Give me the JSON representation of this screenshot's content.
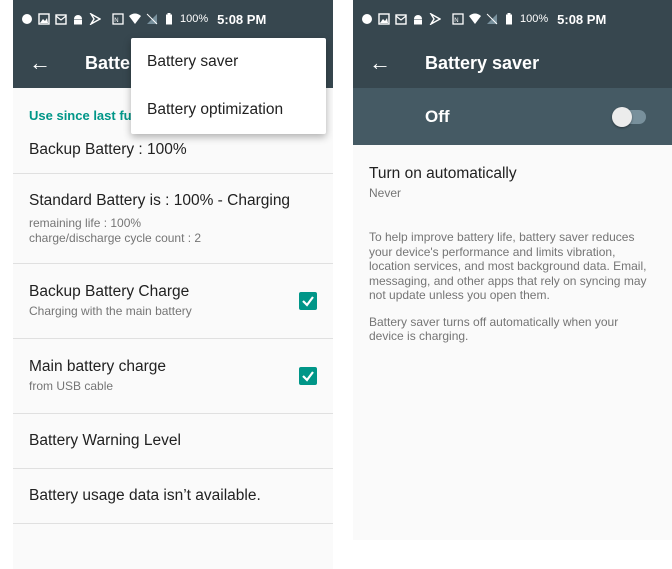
{
  "status_bar": {
    "battery_percent": "100%",
    "time": "5:08 PM",
    "icons": [
      "notification-dot-icon",
      "image-icon",
      "mail-icon",
      "android-icon",
      "flag-icon",
      "nfc-icon",
      "wifi-icon",
      "no-signal-icon",
      "battery-icon"
    ]
  },
  "left_screen": {
    "app_title": "Batte",
    "section_header": "Use since last fu",
    "items": [
      {
        "title": "Backup Battery : 100%",
        "subtitle": null,
        "checked": null
      },
      {
        "title": "Standard Battery is : 100% - Charging",
        "subtitle": "remaining life : 100%",
        "subtitle2": "charge/discharge cycle count : 2",
        "checked": null
      },
      {
        "title": "Backup Battery Charge",
        "subtitle": "Charging with the main battery",
        "checked": true
      },
      {
        "title": "Main battery charge",
        "subtitle": "from USB cable",
        "checked": true
      },
      {
        "title": "Battery Warning Level",
        "subtitle": null,
        "checked": null
      },
      {
        "title": "Battery usage data isn’t available.",
        "subtitle": null,
        "checked": null
      }
    ],
    "overflow_menu": {
      "items": [
        "Battery saver",
        "Battery optimization"
      ]
    }
  },
  "right_screen": {
    "app_title": "Battery saver",
    "switch_label": "Off",
    "switch_on": false,
    "auto_title": "Turn on automatically",
    "auto_value": "Never",
    "description_1": "To help improve battery life, battery saver reduces your device's performance and limits vibration, location services, and most background data. Email, messaging, and other apps that rely on syncing may not update unless you open them.",
    "description_2": "Battery saver turns off automatically when your device is charging."
  },
  "colors": {
    "toolbar": "#37474f",
    "switch_bar": "#455a64",
    "accent": "#009688"
  }
}
